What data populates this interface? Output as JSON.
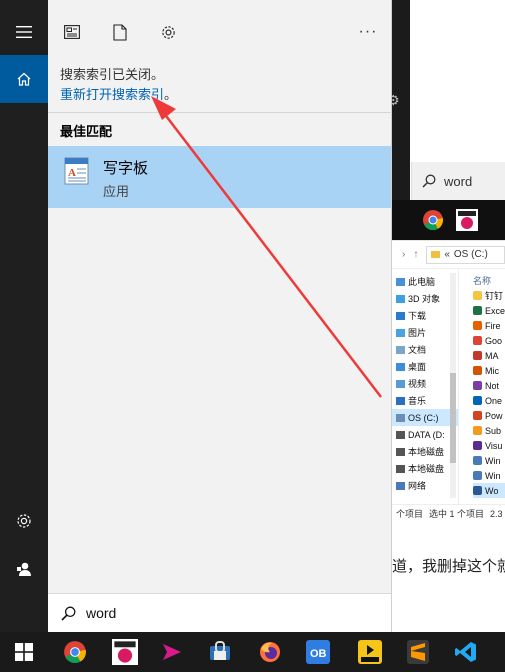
{
  "background": {
    "search_text": "word",
    "explorer": {
      "address": "OS (C:)",
      "address_prefix": "«",
      "nav_items": [
        {
          "label": "此电脑",
          "color": "#4a90d9"
        },
        {
          "label": "3D 对象",
          "color": "#3fa0e0"
        },
        {
          "label": "下载",
          "color": "#2a7bd0"
        },
        {
          "label": "图片",
          "color": "#4aa3df"
        },
        {
          "label": "文档",
          "color": "#7aa7c7"
        },
        {
          "label": "桌面",
          "color": "#3b8fd8"
        },
        {
          "label": "视频",
          "color": "#5a9ad6"
        },
        {
          "label": "音乐",
          "color": "#2a6fc0"
        },
        {
          "label": "OS (C:)",
          "color": "#6a8fb0",
          "active": true
        },
        {
          "label": "DATA (D:",
          "color": "#555555"
        },
        {
          "label": "本地磁盘",
          "color": "#555555"
        },
        {
          "label": "本地磁盘",
          "color": "#555555"
        },
        {
          "label": "网络",
          "color": "#4a7ab8"
        }
      ],
      "file_header": "名称",
      "files": [
        {
          "label": "钉钉",
          "color": "#f5c542"
        },
        {
          "label": "Exce",
          "color": "#1e7145"
        },
        {
          "label": "Fire",
          "color": "#e66000"
        },
        {
          "label": "Goo",
          "color": "#db4437"
        },
        {
          "label": "MA",
          "color": "#c0392b"
        },
        {
          "label": "Mic",
          "color": "#d35400"
        },
        {
          "label": "Not",
          "color": "#7b3fa0"
        },
        {
          "label": "One",
          "color": "#0364b8"
        },
        {
          "label": "Pow",
          "color": "#d04423"
        },
        {
          "label": "Sub",
          "color": "#f29c1f"
        },
        {
          "label": "Visu",
          "color": "#5c2d91"
        },
        {
          "label": "Win",
          "color": "#4a7ab8"
        },
        {
          "label": "Win",
          "color": "#4a7ab8"
        },
        {
          "label": "Wo",
          "color": "#2b579a",
          "active": true
        }
      ],
      "status_count": "个项目",
      "status_selected": "选中 1 个项目",
      "status_size": "2.3"
    },
    "doc_text": "道，我删掉这个就"
  },
  "rail": {
    "menu_icon": "hamburger-icon",
    "home_icon": "home-icon",
    "settings_icon": "gear-icon",
    "user_icon": "user-icon"
  },
  "toolbar": {
    "icons": [
      "news-icon",
      "document-icon",
      "gear-icon"
    ],
    "more_label": "···"
  },
  "notice": {
    "text": "搜索索引已关闭。",
    "link": "重新打开搜索索引",
    "link_suffix": "。"
  },
  "best_match": {
    "heading": "最佳匹配",
    "title": "写字板",
    "type": "应用"
  },
  "search": {
    "query": "word"
  },
  "colors": {
    "accent": "#005a9e",
    "link": "#0063b1",
    "selection": "#a8d3f5",
    "arrow": "#ee3a3a"
  }
}
